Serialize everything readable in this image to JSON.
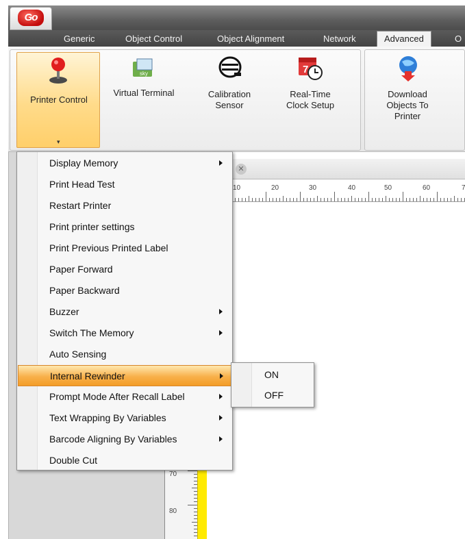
{
  "app": {
    "logo_text": "Go"
  },
  "tabs": [
    {
      "label": "Generic"
    },
    {
      "label": "Object Control"
    },
    {
      "label": "Object Alignment"
    },
    {
      "label": "Network"
    },
    {
      "label": "Advanced"
    },
    {
      "label": "O"
    }
  ],
  "ribbon": {
    "printer_control": {
      "label": "Printer Control",
      "icon": "joystick-icon"
    },
    "virtual_terminal": {
      "label": "Virtual Terminal",
      "icon": "terminal-icon"
    },
    "calibration_sensor": {
      "label_line1": "Calibration",
      "label_line2": "Sensor",
      "icon": "sensor-icon"
    },
    "rtc_setup": {
      "label_line1": "Real-Time",
      "label_line2": "Clock Setup",
      "icon": "calendar-clock-icon",
      "badge": "7"
    },
    "download_objects": {
      "label_line1": "Download",
      "label_line2": "Objects To",
      "label_line3": "Printer",
      "icon": "download-globe-icon"
    }
  },
  "ruler": {
    "h_labels": [
      "10",
      "20",
      "30",
      "40",
      "50",
      "60",
      "7"
    ],
    "v_labels": [
      "70",
      "80"
    ]
  },
  "menu": {
    "items": [
      {
        "label": "Display Memory",
        "submenu": true
      },
      {
        "label": "Print Head Test",
        "submenu": false
      },
      {
        "label": "Restart Printer",
        "submenu": false
      },
      {
        "label": "Print printer settings",
        "submenu": false
      },
      {
        "label": "Print Previous Printed Label",
        "submenu": false
      },
      {
        "label": "Paper Forward",
        "submenu": false
      },
      {
        "label": "Paper Backward",
        "submenu": false
      },
      {
        "label": "Buzzer",
        "submenu": true
      },
      {
        "label": "Switch The Memory",
        "submenu": true
      },
      {
        "label": "Auto Sensing",
        "submenu": false
      },
      {
        "label": "Internal Rewinder",
        "submenu": true,
        "highlighted": true
      },
      {
        "label": "Prompt Mode After Recall Label",
        "submenu": true
      },
      {
        "label": "Text Wrapping By Variables",
        "submenu": true
      },
      {
        "label": "Barcode Aligning By Variables",
        "submenu": true
      },
      {
        "label": "Double Cut",
        "submenu": false
      }
    ]
  },
  "submenu": {
    "items": [
      {
        "label": "ON"
      },
      {
        "label": "OFF"
      }
    ]
  },
  "colors": {
    "highlight": "#f8b04a",
    "selected_ribbon": "#ffdb8a",
    "ruler_strip": "#ffea00",
    "logo_red": "#c40d0d"
  }
}
